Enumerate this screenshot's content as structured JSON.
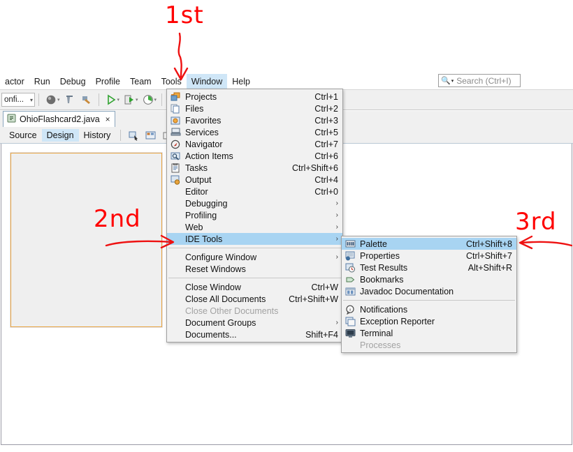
{
  "app": {
    "menubar": [
      {
        "label": "actor",
        "active": false
      },
      {
        "label": "Run",
        "active": false
      },
      {
        "label": "Debug",
        "active": false
      },
      {
        "label": "Profile",
        "active": false
      },
      {
        "label": "Team",
        "active": false
      },
      {
        "label": "Tools",
        "active": false
      },
      {
        "label": "Window",
        "active": true
      },
      {
        "label": "Help",
        "active": false
      }
    ],
    "toolbar": {
      "config_combo": "onfi...",
      "combo_caret": "▾"
    },
    "search": {
      "placeholder": "Search (Ctrl+I)",
      "icon": "magnifier-icon",
      "caret": "▾"
    },
    "editor": {
      "tab_title": "OhioFlashcard2.java",
      "tab_close": "×",
      "views": [
        {
          "label": "Source",
          "selected": false
        },
        {
          "label": "Design",
          "selected": true
        },
        {
          "label": "History",
          "selected": false
        }
      ]
    }
  },
  "window_menu": {
    "items": [
      {
        "label": "Projects",
        "accel": "Ctrl+1",
        "icon": "projects-icon",
        "submenu": false,
        "highlighted": false,
        "disabled": false
      },
      {
        "label": "Files",
        "accel": "Ctrl+2",
        "icon": "files-icon",
        "submenu": false,
        "highlighted": false,
        "disabled": false
      },
      {
        "label": "Favorites",
        "accel": "Ctrl+3",
        "icon": "favorites-icon",
        "submenu": false,
        "highlighted": false,
        "disabled": false
      },
      {
        "label": "Services",
        "accel": "Ctrl+5",
        "icon": "services-icon",
        "submenu": false,
        "highlighted": false,
        "disabled": false
      },
      {
        "label": "Navigator",
        "accel": "Ctrl+7",
        "icon": "navigator-icon",
        "submenu": false,
        "highlighted": false,
        "disabled": false
      },
      {
        "label": "Action Items",
        "accel": "Ctrl+6",
        "icon": "action-items-icon",
        "submenu": false,
        "highlighted": false,
        "disabled": false
      },
      {
        "label": "Tasks",
        "accel": "Ctrl+Shift+6",
        "icon": "tasks-icon",
        "submenu": false,
        "highlighted": false,
        "disabled": false
      },
      {
        "label": "Output",
        "accel": "Ctrl+4",
        "icon": "output-icon",
        "submenu": false,
        "highlighted": false,
        "disabled": false
      },
      {
        "label": "Editor",
        "accel": "Ctrl+0",
        "icon": "",
        "submenu": false,
        "highlighted": false,
        "disabled": false
      },
      {
        "label": "Debugging",
        "accel": "",
        "icon": "",
        "submenu": true,
        "highlighted": false,
        "disabled": false
      },
      {
        "label": "Profiling",
        "accel": "",
        "icon": "",
        "submenu": true,
        "highlighted": false,
        "disabled": false
      },
      {
        "label": "Web",
        "accel": "",
        "icon": "",
        "submenu": true,
        "highlighted": false,
        "disabled": false
      },
      {
        "label": "IDE Tools",
        "accel": "",
        "icon": "",
        "submenu": true,
        "highlighted": true,
        "disabled": false
      },
      {
        "separator": true
      },
      {
        "label": "Configure Window",
        "accel": "",
        "icon": "",
        "submenu": true,
        "highlighted": false,
        "disabled": false
      },
      {
        "label": "Reset Windows",
        "accel": "",
        "icon": "",
        "submenu": false,
        "highlighted": false,
        "disabled": false
      },
      {
        "separator": true
      },
      {
        "label": "Close Window",
        "accel": "Ctrl+W",
        "icon": "",
        "submenu": false,
        "highlighted": false,
        "disabled": false
      },
      {
        "label": "Close All Documents",
        "accel": "Ctrl+Shift+W",
        "icon": "",
        "submenu": false,
        "highlighted": false,
        "disabled": false
      },
      {
        "label": "Close Other Documents",
        "accel": "",
        "icon": "",
        "submenu": false,
        "highlighted": false,
        "disabled": true
      },
      {
        "label": "Document Groups",
        "accel": "",
        "icon": "",
        "submenu": true,
        "highlighted": false,
        "disabled": false
      },
      {
        "label": "Documents...",
        "accel": "Shift+F4",
        "icon": "",
        "submenu": false,
        "highlighted": false,
        "disabled": false
      }
    ]
  },
  "ide_tools_menu": {
    "items": [
      {
        "label": "Palette",
        "accel": "Ctrl+Shift+8",
        "icon": "palette-icon",
        "highlighted": true,
        "disabled": false
      },
      {
        "label": "Properties",
        "accel": "Ctrl+Shift+7",
        "icon": "properties-icon",
        "highlighted": false,
        "disabled": false
      },
      {
        "label": "Test Results",
        "accel": "Alt+Shift+R",
        "icon": "test-results-icon",
        "highlighted": false,
        "disabled": false
      },
      {
        "label": "Bookmarks",
        "accel": "",
        "icon": "bookmarks-icon",
        "highlighted": false,
        "disabled": false
      },
      {
        "label": "Javadoc Documentation",
        "accel": "",
        "icon": "javadoc-icon",
        "highlighted": false,
        "disabled": false
      },
      {
        "separator": true
      },
      {
        "label": "Notifications",
        "accel": "",
        "icon": "notifications-icon",
        "highlighted": false,
        "disabled": false
      },
      {
        "label": "Exception Reporter",
        "accel": "",
        "icon": "exception-icon",
        "highlighted": false,
        "disabled": false
      },
      {
        "label": "Terminal",
        "accel": "",
        "icon": "terminal-icon",
        "highlighted": false,
        "disabled": false
      },
      {
        "label": "Processes",
        "accel": "",
        "icon": "",
        "highlighted": false,
        "disabled": true
      }
    ]
  },
  "annotations": {
    "color": "#ee1111",
    "steps": [
      {
        "label": "1st",
        "target": "Window menu",
        "arrow": "down"
      },
      {
        "label": "2nd",
        "target": "IDE Tools item",
        "arrow": "right"
      },
      {
        "label": "3rd",
        "target": "Palette item",
        "arrow": "left"
      }
    ]
  }
}
